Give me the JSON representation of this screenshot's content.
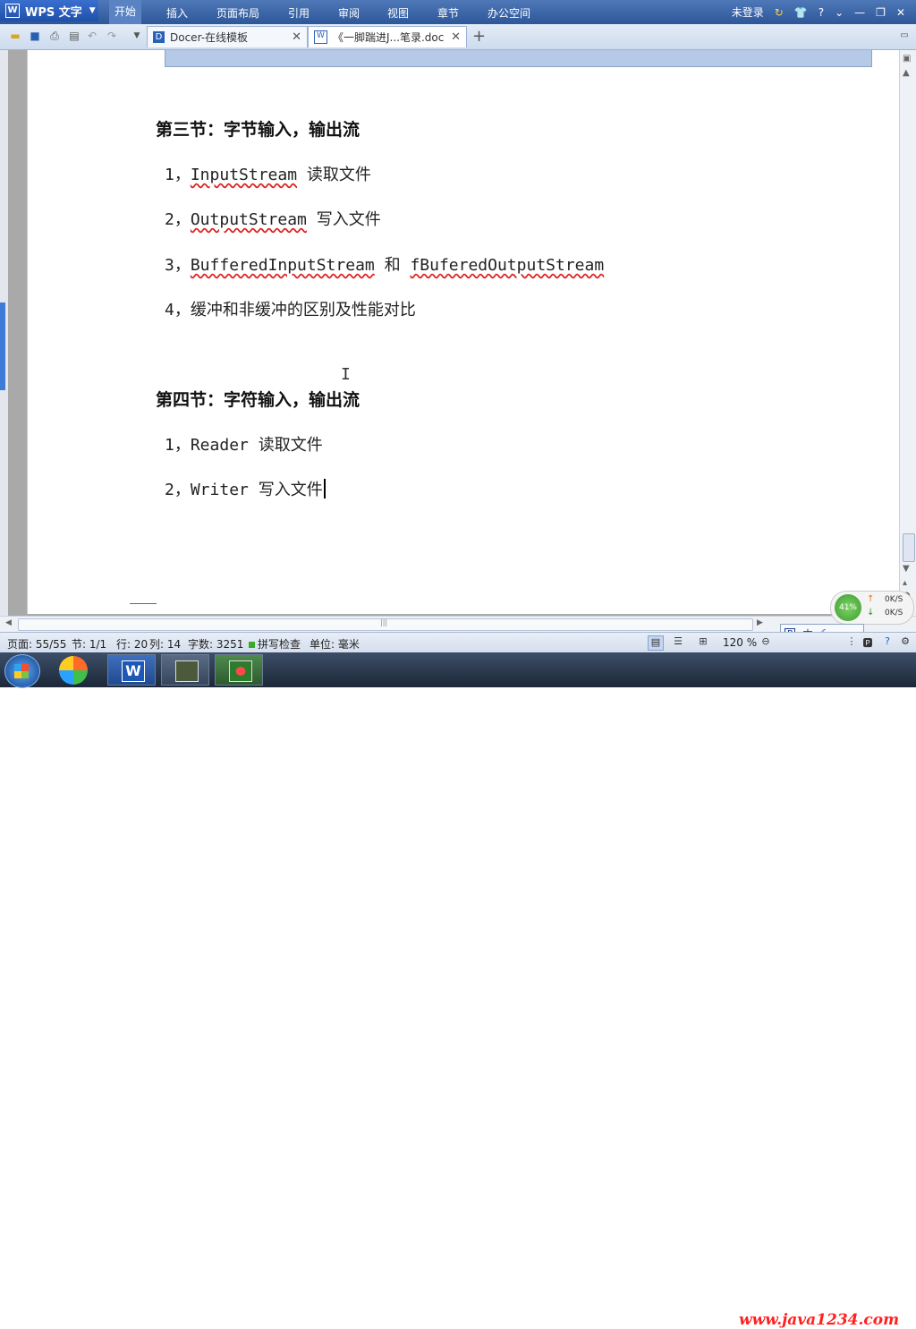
{
  "app": {
    "name": "WPS 文字",
    "logo": "W"
  },
  "menu": [
    "开始",
    "插入",
    "页面布局",
    "引用",
    "审阅",
    "视图",
    "章节",
    "办公空间"
  ],
  "menubar_right": {
    "login": "未登录",
    "help": "?"
  },
  "tabs": [
    {
      "label": "Docer-在线模板",
      "icon": "docer-icon"
    },
    {
      "label": "《一脚踹进J...笔录.doc",
      "icon": "word-doc-icon"
    }
  ],
  "add_tab": "+",
  "document": {
    "section3": {
      "heading": "第三节：字节输入，输出流",
      "items": [
        {
          "num": "1，",
          "code": "InputStream",
          "text": " 读取文件"
        },
        {
          "num": "2，",
          "code": "OutputStream",
          "text": " 写入文件"
        },
        {
          "num": "3，",
          "code": "BufferedInputStream",
          "mid": " 和 ",
          "code2": "fBuferedOutputStream"
        },
        {
          "num": "4，",
          "text": "缓冲和非缓冲的区别及性能对比"
        }
      ]
    },
    "section4": {
      "heading": "第四节：字符输入，输出流",
      "items": [
        {
          "num": "1，",
          "text": "Reader 读取文件"
        },
        {
          "num": "2，",
          "text": "Writer 写入文件"
        }
      ]
    }
  },
  "ibeam": "I",
  "network": {
    "percent": "41%",
    "up": "0K/S",
    "down": "0K/S"
  },
  "status": {
    "page": "页面: 55/55",
    "section": "节: 1/1",
    "row": "行: 20",
    "col": "列: 14",
    "words": "字数: 3251",
    "spell": "拼写检查",
    "unit": "单位: 毫米",
    "zoom": "120 %"
  },
  "ime": {
    "mode": "中"
  },
  "watermark": "www.java1234.com"
}
